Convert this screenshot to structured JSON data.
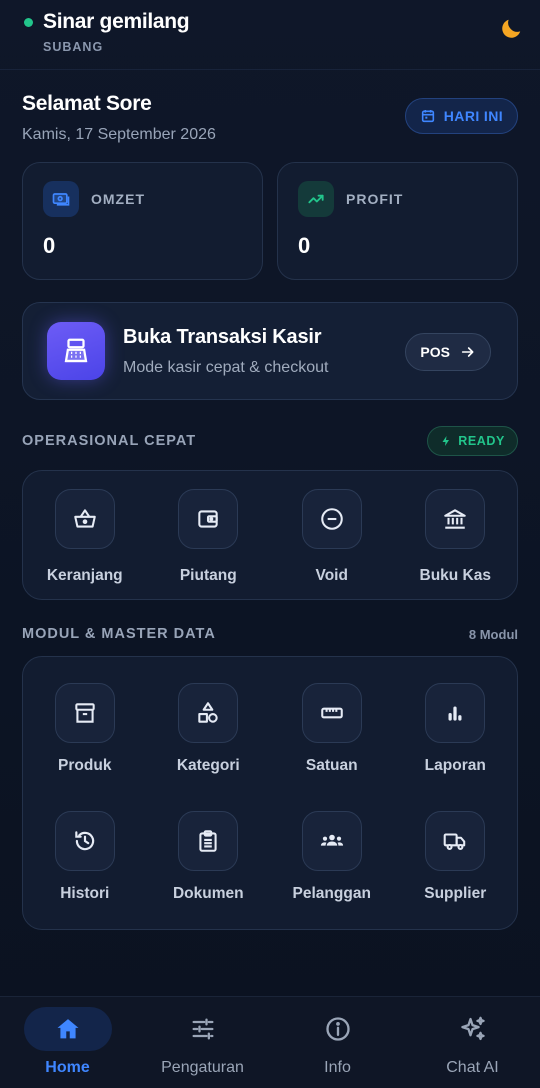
{
  "header": {
    "store_name": "Sinar gemilang",
    "store_location": "SUBANG",
    "status_color": "#22c58b",
    "theme_icon": "moon-icon"
  },
  "greeting": {
    "title": "Selamat Sore",
    "date": "Kamis, 17 September 2026",
    "today_label": "HARI INI"
  },
  "stats": {
    "omzet_label": "OMZET",
    "omzet_value": "0",
    "profit_label": "PROFIT",
    "profit_value": "0"
  },
  "pos": {
    "title": "Buka Transaksi Kasir",
    "subtitle": "Mode kasir cepat & checkout",
    "button_label": "POS"
  },
  "operations": {
    "title": "OPERASIONAL CEPAT",
    "badge": "READY",
    "items": [
      {
        "label": "Keranjang",
        "icon": "basket-icon"
      },
      {
        "label": "Piutang",
        "icon": "wallet-icon"
      },
      {
        "label": "Void",
        "icon": "minus-circle-icon"
      },
      {
        "label": "Buku Kas",
        "icon": "bank-icon"
      }
    ]
  },
  "modules": {
    "title": "MODUL & MASTER DATA",
    "count": "8 Modul",
    "items": [
      {
        "label": "Produk",
        "icon": "archive-box-icon"
      },
      {
        "label": "Kategori",
        "icon": "shapes-icon"
      },
      {
        "label": "Satuan",
        "icon": "ruler-icon"
      },
      {
        "label": "Laporan",
        "icon": "bar-chart-icon"
      },
      {
        "label": "Histori",
        "icon": "history-icon"
      },
      {
        "label": "Dokumen",
        "icon": "clipboard-icon"
      },
      {
        "label": "Pelanggan",
        "icon": "group-icon"
      },
      {
        "label": "Supplier",
        "icon": "truck-icon"
      }
    ]
  },
  "nav": {
    "items": [
      {
        "label": "Home",
        "icon": "home-icon"
      },
      {
        "label": "Pengaturan",
        "icon": "sliders-icon"
      },
      {
        "label": "Info",
        "icon": "info-icon"
      },
      {
        "label": "Chat AI",
        "icon": "sparkles-icon"
      }
    ]
  },
  "colors": {
    "accent": "#3f86ff",
    "success": "#22c58b",
    "pos_purple": "#5b50f0",
    "background": "#0c1322"
  }
}
